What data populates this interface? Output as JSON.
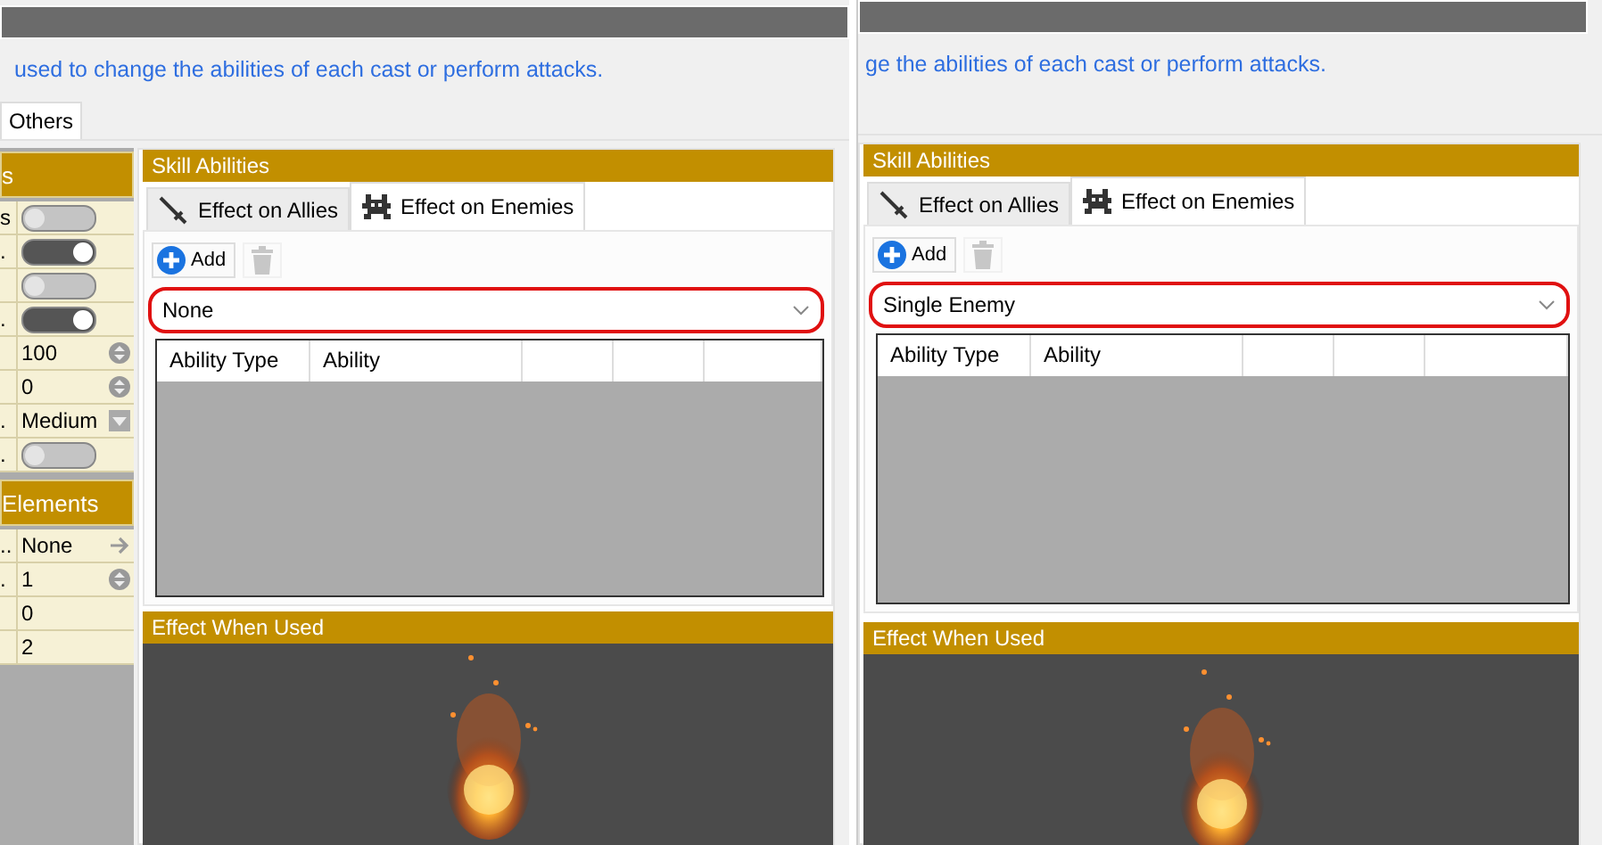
{
  "panels": [
    {
      "description": "used to change the abilities of each cast or perform attacks.",
      "tabs": [
        {
          "label": "Others",
          "selected": true
        }
      ],
      "properties": {
        "title": "s",
        "rows": [
          {
            "label": "s",
            "kind": "toggle",
            "on": false
          },
          {
            "label": ".",
            "kind": "toggle",
            "on": true
          },
          {
            "kind": "toggle",
            "on": false
          },
          {
            "label": ".",
            "kind": "toggle",
            "on": true
          },
          {
            "kind": "spinner",
            "value": "100"
          },
          {
            "kind": "spinner",
            "value": "0"
          },
          {
            "label": ".",
            "kind": "dropdown",
            "value": "Medium"
          },
          {
            "label": ".",
            "kind": "toggle",
            "on": false
          }
        ],
        "elements_title": "Elements",
        "elements": [
          {
            "label": "..",
            "kind": "link",
            "value": "None"
          },
          {
            "label": ".",
            "kind": "spinner",
            "value": "1"
          },
          {
            "kind": "text",
            "value": "0"
          },
          {
            "kind": "text",
            "value": "2"
          }
        ]
      },
      "skill_abilities": {
        "title": "Skill Abilities",
        "tabs": [
          {
            "label": "Effect on Allies",
            "kind": "allies",
            "selected": false
          },
          {
            "label": "Effect on Enemies",
            "kind": "enemies",
            "selected": true
          }
        ],
        "add_label": "Add",
        "delete_disabled": true,
        "target": "None",
        "highlighted": true,
        "columns": [
          "Ability Type",
          "Ability"
        ]
      },
      "effect": {
        "title": "Effect When Used"
      }
    },
    {
      "description": "ge the abilities of each cast or perform attacks.",
      "skill_abilities": {
        "title": "Skill Abilities",
        "tabs": [
          {
            "label": "Effect on Allies",
            "kind": "allies",
            "selected": false
          },
          {
            "label": "Effect on Enemies",
            "kind": "enemies",
            "selected": true
          }
        ],
        "add_label": "Add",
        "delete_disabled": true,
        "target": "Single Enemy",
        "highlighted": true,
        "columns": [
          "Ability Type",
          "Ability"
        ]
      },
      "effect": {
        "title": "Effect When Used"
      }
    }
  ]
}
